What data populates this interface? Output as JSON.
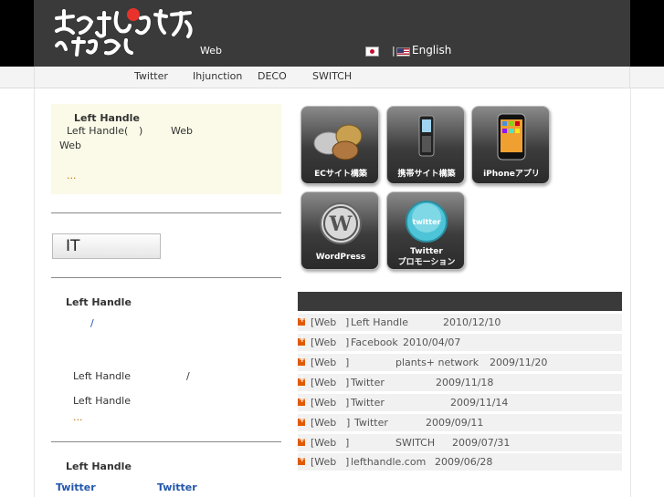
{
  "header": {
    "tagline": "Web",
    "lang_sep": "|",
    "lang_en": "English"
  },
  "nav": {
    "items": [
      "Twitter",
      "Ihjunction",
      "DECO",
      "SWITCH"
    ]
  },
  "about": {
    "title": "Left Handle",
    "line1_a": "Left Handle(",
    "line1_b": ")",
    "line1_c": "Web",
    "line2": "Web",
    "more": "..."
  },
  "it_banner": "IT",
  "company": {
    "title": "Left Handle",
    "slash1": "/",
    "line_a": "Left Handle",
    "slash2": "/",
    "line_b": "Left Handle",
    "more": "..."
  },
  "twitter_section": {
    "title": "Left Handle",
    "link_a": "Twitter",
    "link_b": "Twitter"
  },
  "services": [
    {
      "label": "ECサイト構築",
      "icon": "coins-icon"
    },
    {
      "label": "携帯サイト構築",
      "icon": "mobile-phone-icon"
    },
    {
      "label": "iPhoneアプリ",
      "icon": "iphone-icon"
    },
    {
      "label": "WordPress",
      "icon": "wordpress-icon"
    },
    {
      "label_a": "Twitter",
      "label_b": "プロモーション",
      "icon": "twitter-bird-icon"
    }
  ],
  "news": [
    {
      "cat": "[Web",
      "close": "]",
      "text": "Left Handle",
      "date": "2010/12/10"
    },
    {
      "cat": "[Web",
      "close": "]",
      "text": "Facebook",
      "date": "2010/04/07"
    },
    {
      "cat": "[Web",
      "close": "]",
      "text": "plants+ network",
      "date": "2009/11/20"
    },
    {
      "cat": "[Web",
      "close": "]",
      "text": "Twitter",
      "date": "2009/11/18"
    },
    {
      "cat": "[Web",
      "close": "]",
      "text": "Twitter",
      "date": "2009/11/14"
    },
    {
      "cat": "[Web",
      "close": "]",
      "text": "Twitter",
      "date": "2009/09/11"
    },
    {
      "cat": "[Web",
      "close": "]",
      "text": "SWITCH",
      "date": "2009/07/31"
    },
    {
      "cat": "[Web",
      "close": "]",
      "text": "lefthandle.com",
      "date": "2009/06/28"
    }
  ],
  "colors": {
    "header_bg": "#3a3a3a",
    "about_bg": "#fbfae8",
    "accent_orange": "#e05a00"
  }
}
